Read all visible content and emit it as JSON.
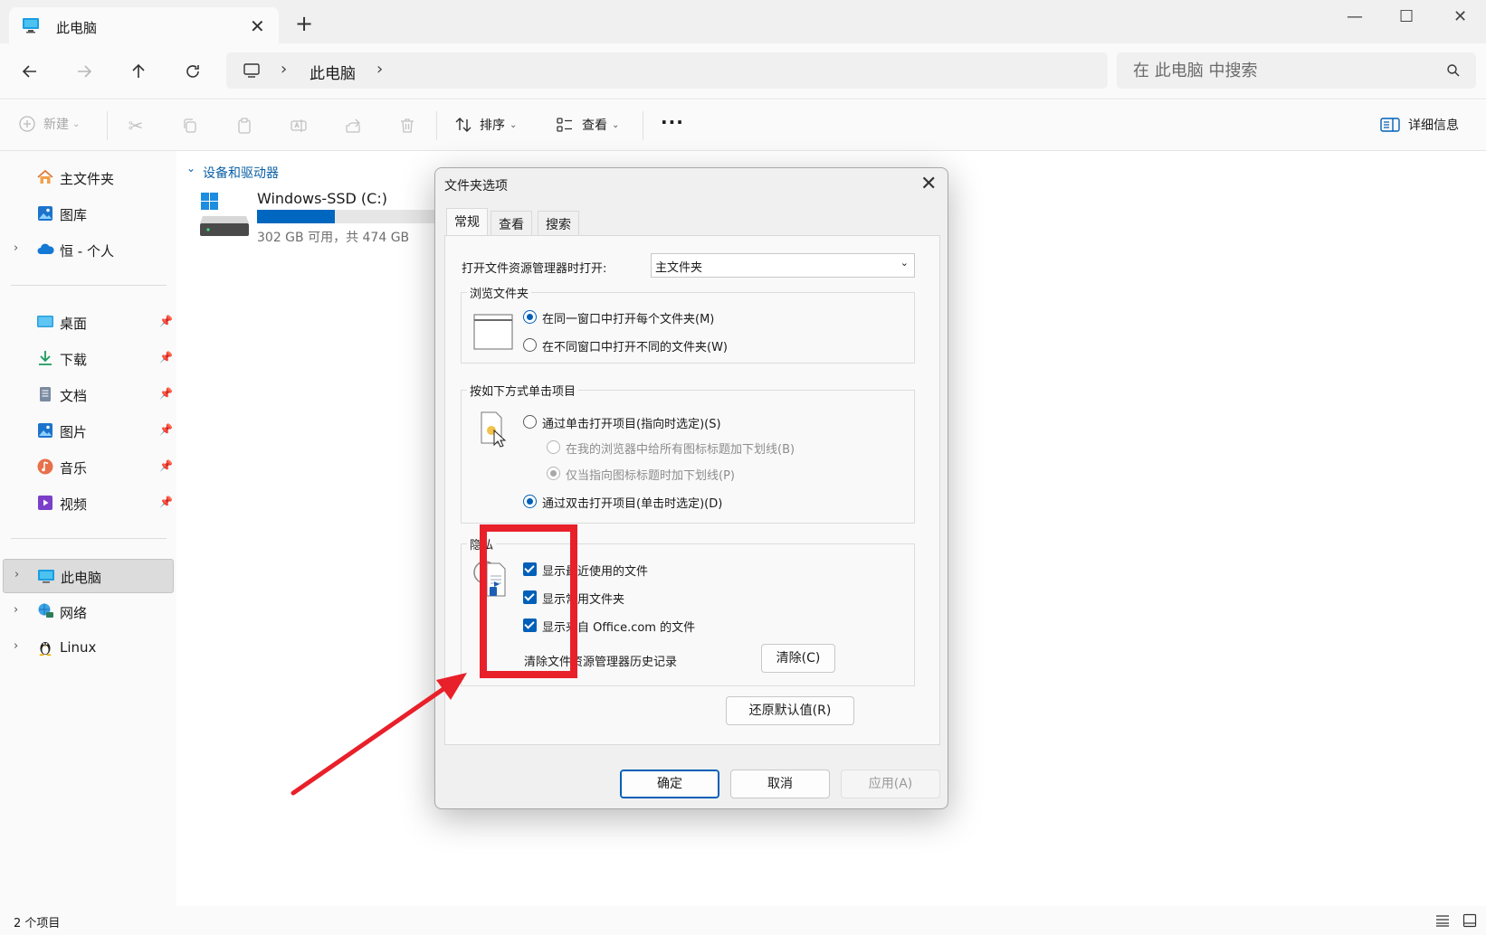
{
  "window": {
    "tab_title": "此电脑",
    "new_tab": "+",
    "minimize": "—",
    "maximize": "☐",
    "close": "✕"
  },
  "address": {
    "separator": "›",
    "location": "此电脑",
    "search_placeholder": "在 此电脑 中搜索"
  },
  "toolbar": {
    "new_label": "新建",
    "sort_label": "排序",
    "view_label": "查看",
    "more_label": "···",
    "details_label": "详细信息"
  },
  "sidebar": {
    "items": [
      {
        "label": "主文件夹"
      },
      {
        "label": "图库"
      },
      {
        "label": "恒 - 个人"
      },
      {
        "label": "桌面"
      },
      {
        "label": "下载"
      },
      {
        "label": "文档"
      },
      {
        "label": "图片"
      },
      {
        "label": "音乐"
      },
      {
        "label": "视频"
      },
      {
        "label": "此电脑"
      },
      {
        "label": "网络"
      },
      {
        "label": "Linux"
      }
    ]
  },
  "content": {
    "group_header": "设备和驱动器",
    "drive": {
      "name": "Windows-SSD (C:)",
      "detail": "302 GB 可用，共 474 GB",
      "used_fraction": 0.36
    }
  },
  "status": {
    "item_count": "2 个项目"
  },
  "dialog": {
    "title": "文件夹选项",
    "tabs": [
      "常规",
      "查看",
      "搜索"
    ],
    "open_label": "打开文件资源管理器时打开:",
    "open_value": "主文件夹",
    "browse_group": "浏览文件夹",
    "browse_same": "在同一窗口中打开每个文件夹(M)",
    "browse_new": "在不同窗口中打开不同的文件夹(W)",
    "click_group": "按如下方式单击项目",
    "single_click": "通过单击打开项目(指向时选定)(S)",
    "underline_all": "在我的浏览器中给所有图标标题加下划线(B)",
    "underline_point": "仅当指向图标标题时加下划线(P)",
    "double_click": "通过双击打开项目(单击时选定)(D)",
    "privacy_group": "隐私",
    "show_recent": "显示最近使用的文件",
    "show_frequent": "显示常用文件夹",
    "show_office": "显示来自 Office.com 的文件",
    "clear_history": "清除文件资源管理器历史记录",
    "clear_button": "清除(C)",
    "restore_button": "还原默认值(R)",
    "ok_button": "确定",
    "cancel_button": "取消",
    "apply_button": "应用(A)"
  },
  "colors": {
    "accent": "#005fb8",
    "highlight": "#e8202a"
  }
}
